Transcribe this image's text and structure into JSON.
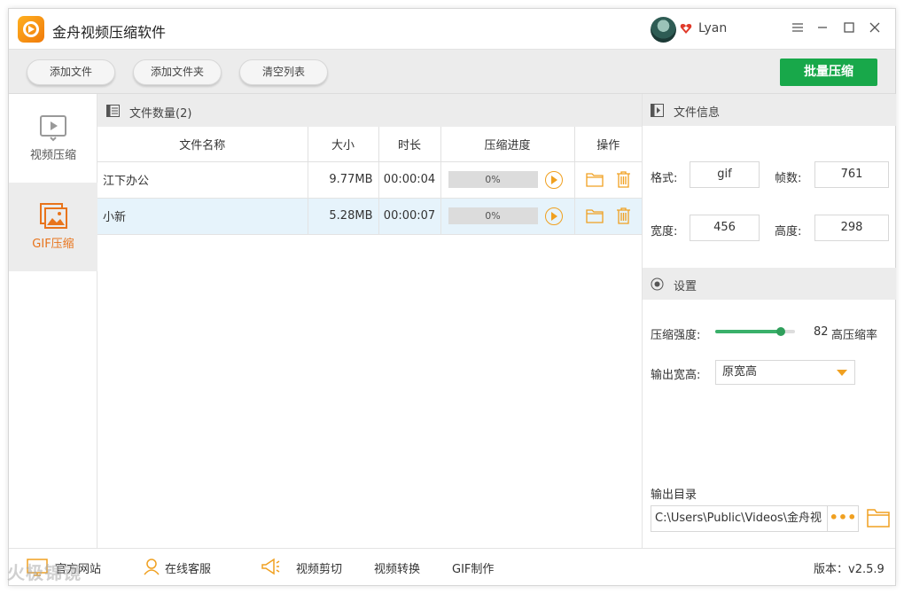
{
  "app": {
    "title": "金舟视频压缩软件",
    "username": "Lyan"
  },
  "toolbar": {
    "add_file": "添加文件",
    "add_folder": "添加文件夹",
    "clear_list": "清空列表",
    "batch_compress": "批量压缩"
  },
  "nav": [
    {
      "label": "视频压缩",
      "active": false
    },
    {
      "label": "GIF压缩",
      "active": true
    }
  ],
  "filelist": {
    "header": "文件数量(2)",
    "columns": [
      "文件名称",
      "大小",
      "时长",
      "压缩进度",
      "操作"
    ],
    "rows": [
      {
        "name": "江下办公",
        "size": "9.77MB",
        "duration": "00:00:04",
        "progress": "0%"
      },
      {
        "name": "小新",
        "size": "5.28MB",
        "duration": "00:00:07",
        "progress": "0%"
      }
    ]
  },
  "fileinfo": {
    "header": "文件信息",
    "format_label": "格式:",
    "format": "gif",
    "frames_label": "帧数:",
    "frames": "761",
    "width_label": "宽度:",
    "width": "456",
    "height_label": "高度:",
    "height": "298"
  },
  "settings": {
    "header": "设置",
    "strength_label": "压缩强度:",
    "strength_value": "82",
    "strength_text": "高压缩率",
    "strength_fraction": 0.82,
    "output_size_label": "输出宽高:",
    "output_size": "原宽高",
    "output_dir_label": "输出目录",
    "output_dir": "C:\\Users\\Public\\Videos\\金舟视"
  },
  "footer": {
    "website": "官方网站",
    "service": "在线客服",
    "video_cut": "视频剪切",
    "video_convert": "视频转换",
    "gif_make": "GIF制作",
    "version": "版本：v2.5.9"
  },
  "watermark": "火极锦镜",
  "colors": {
    "accent": "#f0a020",
    "primary_green": "#18a84a",
    "selected_row": "#e6f3fb"
  }
}
